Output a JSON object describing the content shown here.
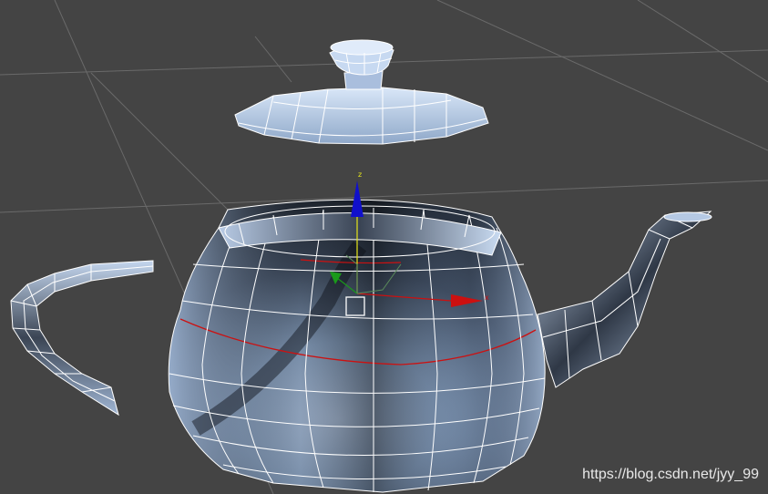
{
  "viewport": {
    "background": "#444444",
    "grid_color": "#6a6a6a",
    "mesh_fill_light": "#c9dcf4",
    "mesh_fill_dark": "#1a1f27",
    "wire_color": "#ffffff",
    "selection_edge_color": "#cc1111"
  },
  "gizmo": {
    "z_label": "z",
    "x_label": "x",
    "z_color": "#1010cc",
    "x_color": "#cc1010",
    "y_color": "#1a9a1a",
    "z_axis_color": "#e6e61a"
  },
  "watermark": "https://blog.csdn.net/jyy_99"
}
